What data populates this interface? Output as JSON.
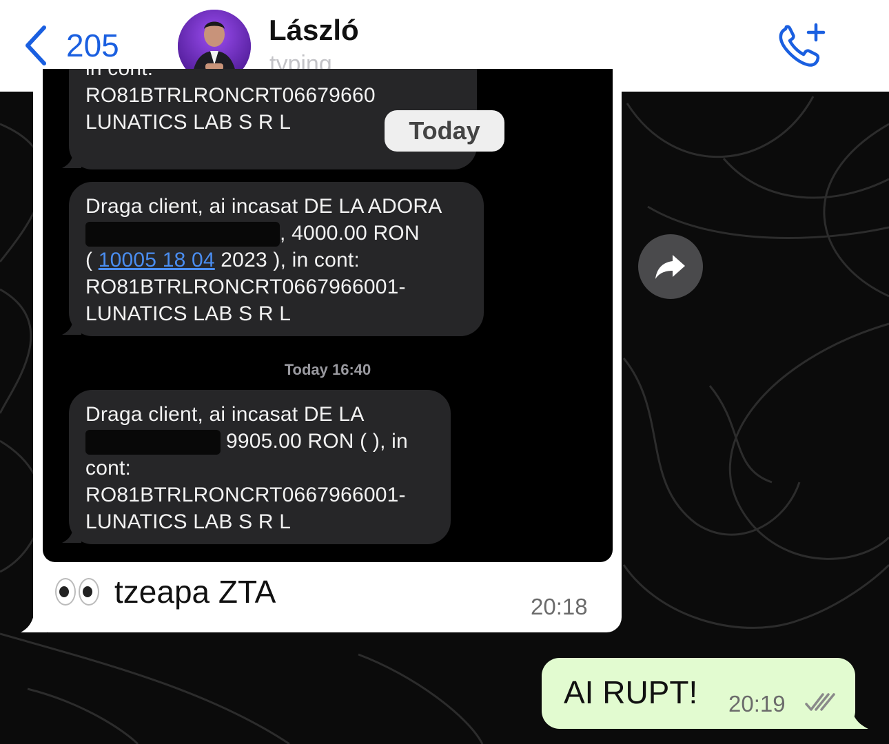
{
  "header": {
    "back_count": "205",
    "contact_name": "László",
    "contact_status": "typing..."
  },
  "incoming": {
    "screenshot": {
      "sms_top": {
        "line_cut": "in cont:",
        "line1": "RO81BTRLRONCRT06679660",
        "line2": "LUNATICS LAB S R L"
      },
      "sms_middle": {
        "line1": " Draga client, ai incasat DE LA ADORA",
        "line2_end": ", 4000.00 RON",
        "line3_open": "( ",
        "line3_link": "10005 18 04",
        "line3_rest": " 2023 ), in cont:",
        "line4": "RO81BTRLRONCRT0667966001-",
        "line5": "LUNATICS LAB S R L"
      },
      "time_label": "Today 16:40",
      "sms_bottom": {
        "line1": " Draga client, ai incasat DE LA",
        "line2_end": "9905.00 RON (  ), in",
        "line3": "cont:",
        "line4": "RO81BTRLRONCRT0667966001-",
        "line5": "LUNATICS LAB S R L"
      }
    },
    "today_pill": "Today",
    "caption": "tzeapa ZTA",
    "time": "20:18"
  },
  "outgoing": {
    "text": "AI RUPT!",
    "time": "20:19",
    "status": "read"
  },
  "icons": {
    "back": "chevron-left-icon",
    "call": "phone-add-icon",
    "forward": "forward-arrow-icon",
    "read": "double-check-icon"
  },
  "colors": {
    "accent": "#1a5fe0",
    "outgoing_bubble": "#e2fbd0",
    "incoming_bubble": "#ffffff",
    "chat_background": "#0b0b0b"
  }
}
